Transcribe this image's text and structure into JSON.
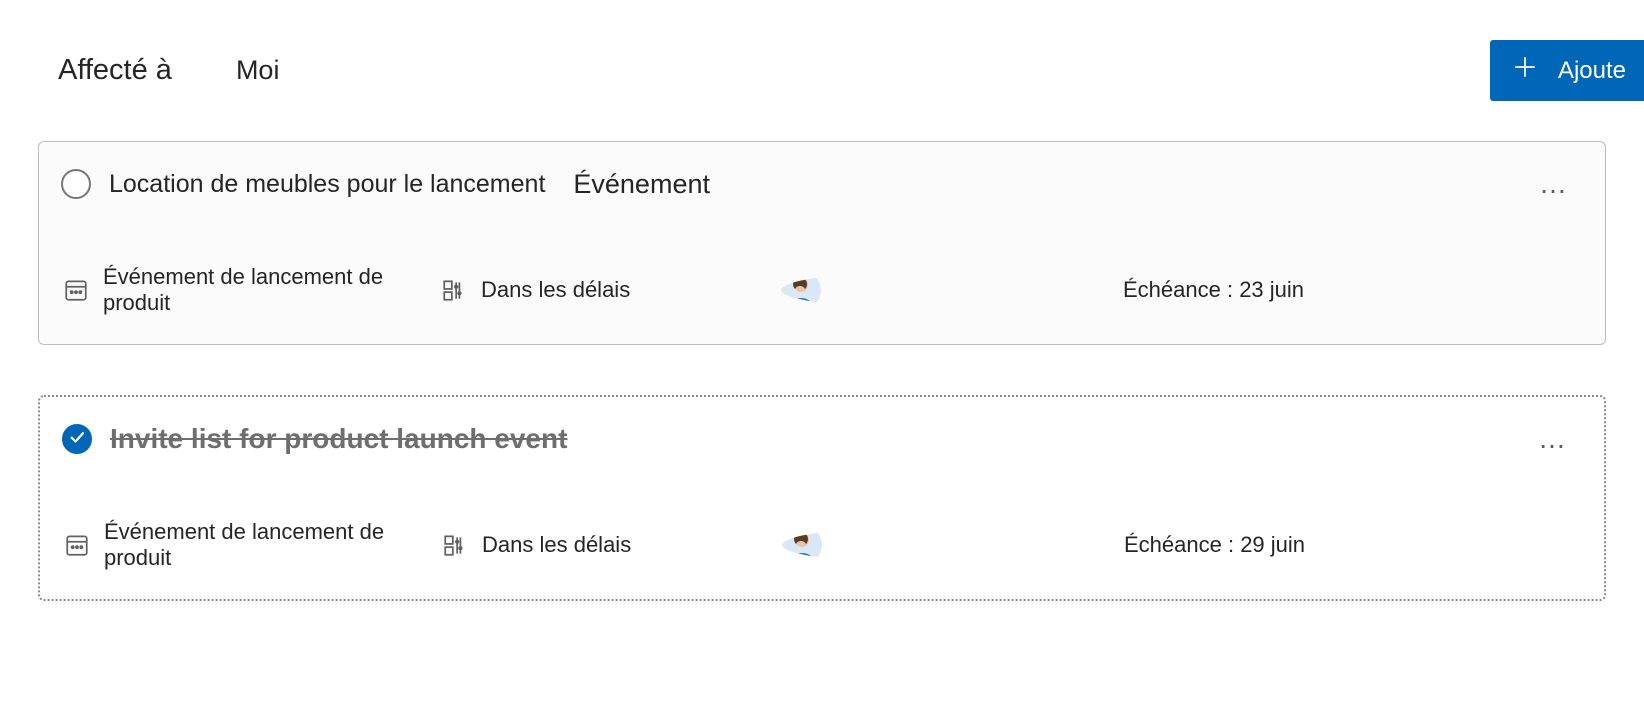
{
  "header": {
    "assigned_label": "Affecté à",
    "assigned_value": "Moi",
    "add_label": "Ajoute"
  },
  "tasks": [
    {
      "completed": false,
      "title": "Location de meubles pour le lancement",
      "category": "Événement",
      "plan": "Événement de lancement de produit",
      "status": "Dans les délais",
      "due": "Échéance : 23 juin"
    },
    {
      "completed": true,
      "title": "Invite list for product launch event",
      "category": "",
      "plan": "Événement de lancement de produit",
      "status": "Dans les délais",
      "due": "Échéance : 29 juin"
    }
  ]
}
